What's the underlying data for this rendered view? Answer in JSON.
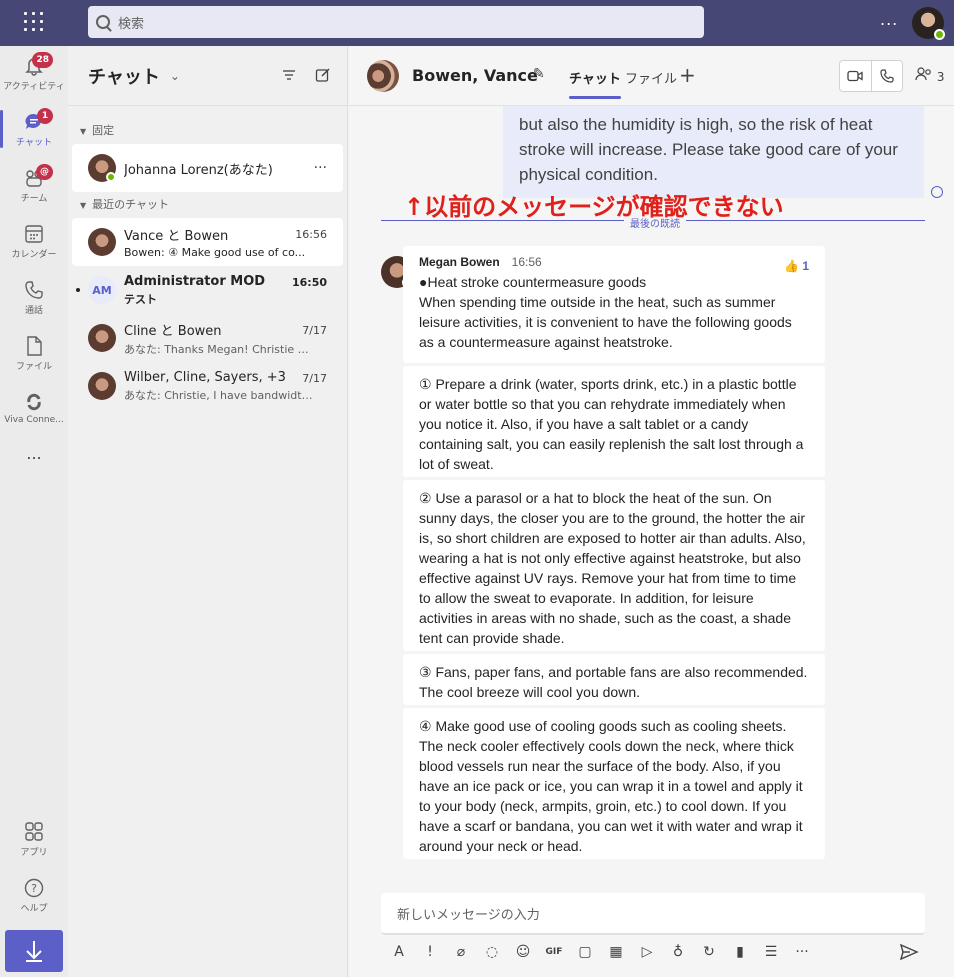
{
  "topbar": {
    "search_placeholder": "検索",
    "more": "..."
  },
  "rail": {
    "items": [
      {
        "label": "アクティビティ",
        "badge": "28"
      },
      {
        "label": "チャット",
        "badge": "1"
      },
      {
        "label": "チーム",
        "badge": "@"
      },
      {
        "label": "カレンダー"
      },
      {
        "label": "通話"
      },
      {
        "label": "ファイル"
      },
      {
        "label": "Viva Conne..."
      },
      {
        "label": "..."
      }
    ],
    "bottom": [
      {
        "label": "アプリ"
      },
      {
        "label": "ヘルプ"
      }
    ]
  },
  "chatlist": {
    "title": "チャット",
    "pinned_label": "固定",
    "recent_label": "最近のチャット",
    "pinned": [
      {
        "name": "Johanna Lorenz(あなた)"
      }
    ],
    "recent": [
      {
        "name": "Vance と Bowen",
        "time": "16:56",
        "preview": "Bowen: ④ Make good use of co..."
      },
      {
        "name": "Administrator MOD",
        "initials": "AM",
        "time": "16:50",
        "preview": "テスト"
      },
      {
        "name": "Cline と Bowen",
        "time": "7/17",
        "preview": "あなた: Thanks Megan! Christie Cli..."
      },
      {
        "name": "Wilber, Cline, Sayers, +3",
        "time": "7/17",
        "preview": "あなた: Christie, I have bandwidth ..."
      }
    ]
  },
  "conversation": {
    "title": "Bowen, Vance",
    "tabs": [
      "チャット",
      "ファイル"
    ],
    "participants": "3",
    "previous_text": "but also the humidity is high, so the risk of heat stroke will increase. Please take good care of your physical condition.",
    "annotation": "↑以前のメッセージが確認できない",
    "last_read": "最後の既読",
    "message": {
      "author": "Megan Bowen",
      "time": "16:56",
      "reaction_count": "1",
      "parts": [
        "●Heat stroke countermeasure goods\nWhen spending time outside in the heat, such as summer leisure activities, it is convenient to have the following goods as a countermeasure against heatstroke.",
        "① Prepare a drink (water, sports drink, etc.) in a plastic bottle or water bottle so that you can rehydrate immediately when you notice it. Also, if you have a salt tablet or a candy containing salt, you can easily replenish the salt lost through a lot of sweat.",
        "② Use a parasol or a hat to block the heat of the sun. On sunny days, the closer you are to the ground, the hotter the air is, so short children are exposed to hotter air than adults. Also, wearing a hat is not only effective against heatstroke, but also effective against UV rays. Remove your hat from time to time to allow the sweat to evaporate. In addition, for leisure activities in areas with no shade, such as the coast, a shade tent can provide shade.",
        "③ Fans, paper fans, and portable fans are also recommended. The cool breeze will cool you down.",
        "④ Make good use of cooling goods such as cooling sheets. The neck cooler effectively cools down the neck, where thick blood vessels run near the surface of the body. Also, if you have an ice pack or ice, you can wrap it in a towel and apply it to your body (neck, armpits, groin, etc.) to cool down. If you have a scarf or bandana, you can wet it with water and wrap it around your neck or head."
      ]
    },
    "composer_placeholder": "新しいメッセージの入力"
  }
}
